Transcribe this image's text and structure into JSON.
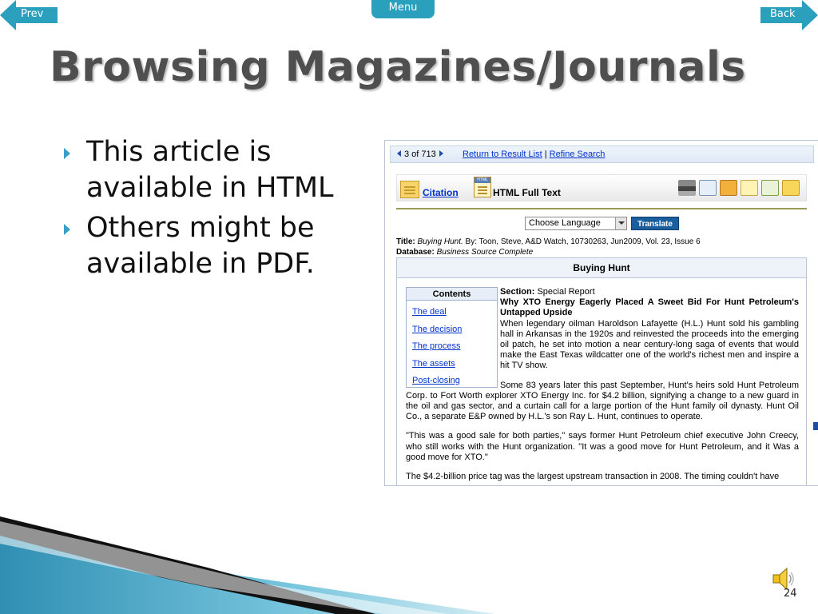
{
  "nav": {
    "prev": "Prev",
    "menu": "Menu",
    "back": "Back"
  },
  "title": "Browsing Magazines/Journals",
  "bullets": [
    "This article is available in HTML",
    "Others might be available in PDF."
  ],
  "screenshot": {
    "pager": "3 of 713",
    "return_link": "Return to Result List",
    "separator": "|",
    "refine_link": "Refine Search",
    "citation": "Citation",
    "html_badge": "HTML",
    "html_full_text": "HTML Full Text",
    "language_select": "Choose Language",
    "translate_button": "Translate",
    "meta": {
      "title_label": "Title:",
      "title_value": "Buying Hunt.",
      "title_rest": " By: Toon, Steve, A&D Watch, 10730263, Jun2009, Vol. 23, Issue 6",
      "database_label": "Database:",
      "database_value": "Business Source Complete"
    },
    "article_heading": "Buying Hunt",
    "contents": {
      "heading": "Contents",
      "items": [
        "The deal",
        "The decision",
        "The process",
        "The assets",
        "Post-closing"
      ]
    },
    "section_label": "Section:",
    "section_value": "Special Report",
    "headline": "Why XTO Energy Eagerly Placed A Sweet Bid For Hunt Petroleum's Untapped Upside",
    "paragraphs": [
      "When legendary oilman Haroldson Lafayette (H.L.) Hunt sold his gambling hall in Arkansas in the 1920s and reinvested the proceeds into the emerging oil patch, he set into motion a near century-long saga of events that would make the East Texas wildcatter one of the world's richest men and inspire a hit TV show.",
      "Some 83 years later this past September, Hunt's heirs sold Hunt Petroleum Corp. to Fort Worth explorer XTO Energy Inc. for $4.2 billion, signifying a change to a new guard in the oil and gas sector, and a curtain call for a large portion of the Hunt family oil dynasty. Hunt Oil Co., a separate E&P owned by H.L.'s son Ray L. Hunt, continues to operate.",
      "\"This was a good sale for both parties,\" says former Hunt Petroleum chief executive John Creecy, who still works with the Hunt organization. \"It was a good move for Hunt Petroleum, and it Was a good move for XTO.\"",
      "The $4.2-billion price tag was the largest upstream transaction in 2008. The timing couldn't have"
    ]
  },
  "page_number": "24",
  "colors": {
    "accent": "#2aa0bd",
    "title": "#4f4f4f",
    "link": "#0033cc"
  }
}
